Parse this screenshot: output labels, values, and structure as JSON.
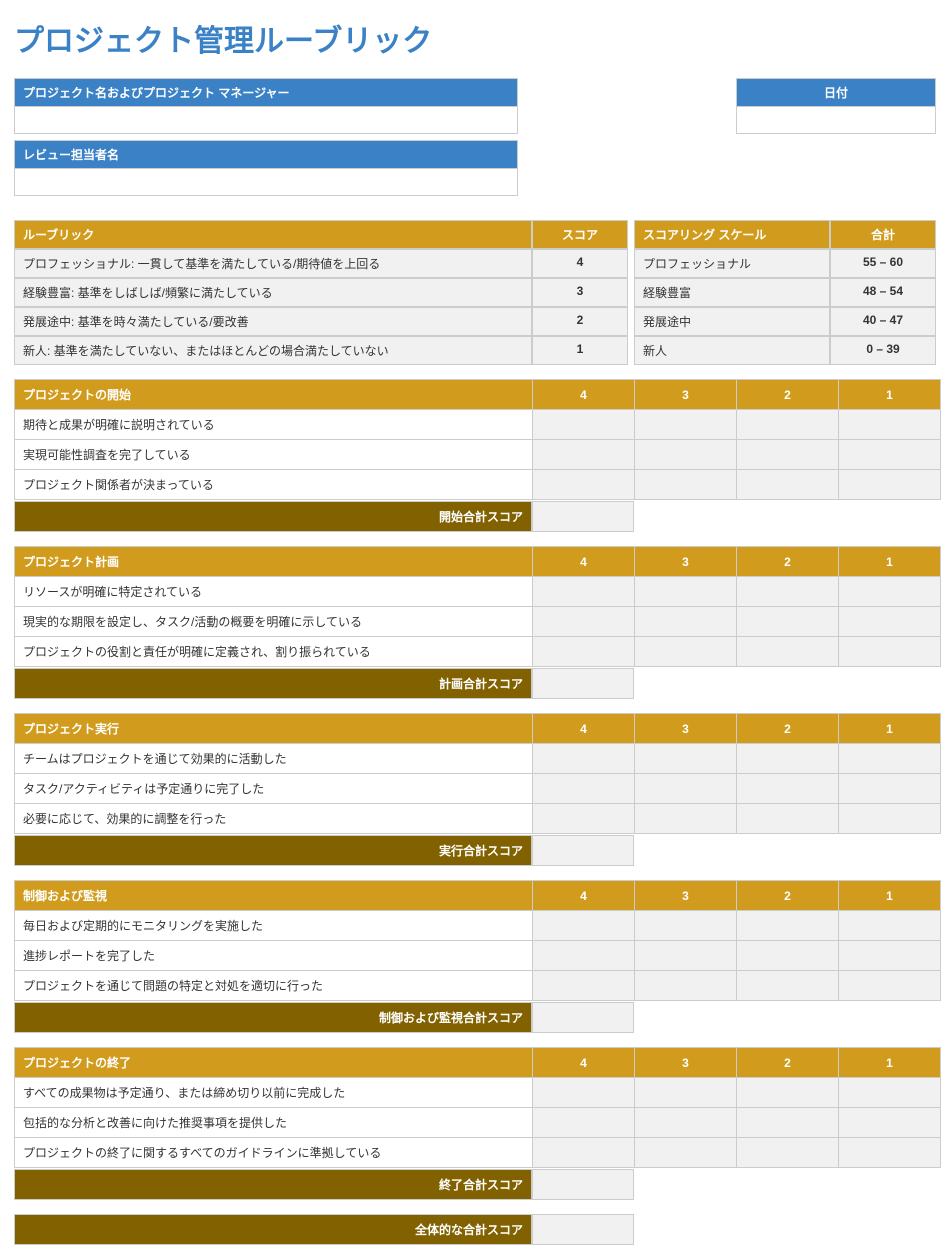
{
  "title": "プロジェクト管理ルーブリック",
  "info": {
    "project_header": "プロジェクト名およびプロジェクト マネージャー",
    "project_value": "",
    "reviewer_header": "レビュー担当者名",
    "reviewer_value": "",
    "date_header": "日付",
    "date_value": ""
  },
  "rubric": {
    "rubric_header": "ルーブリック",
    "score_header": "スコア",
    "scale_header": "スコアリング スケール",
    "total_header": "合計",
    "rows": [
      {
        "desc": "プロフェッショナル: 一貫して基準を満たしている/期待値を上回る",
        "score": "4",
        "scale": "プロフェッショナル",
        "range": "55 – 60"
      },
      {
        "desc": "経験豊富: 基準をしばしば/頻繁に満たしている",
        "score": "3",
        "scale": "経験豊富",
        "range": "48 – 54"
      },
      {
        "desc": "発展途中: 基準を時々満たしている/要改善",
        "score": "2",
        "scale": "発展途中",
        "range": "40 – 47"
      },
      {
        "desc": "新人: 基準を満たしていない、またはほとんどの場合満たしていない",
        "score": "1",
        "scale": "新人",
        "range": "0 – 39"
      }
    ]
  },
  "score_cols": [
    "4",
    "3",
    "2",
    "1"
  ],
  "sections": [
    {
      "title": "プロジェクトの開始",
      "rows": [
        "期待と成果が明確に説明されている",
        "実現可能性調査を完了している",
        "プロジェクト関係者が決まっている"
      ],
      "subtotal_label": "開始合計スコア",
      "subtotal_value": ""
    },
    {
      "title": "プロジェクト計画",
      "rows": [
        "リソースが明確に特定されている",
        "現実的な期限を設定し、タスク/活動の概要を明確に示している",
        "プロジェクトの役割と責任が明確に定義され、割り振られている"
      ],
      "subtotal_label": "計画合計スコア",
      "subtotal_value": ""
    },
    {
      "title": "プロジェクト実行",
      "rows": [
        "チームはプロジェクトを通じて効果的に活動した",
        "タスク/アクティビティは予定通りに完了した",
        "必要に応じて、効果的に調整を行った"
      ],
      "subtotal_label": "実行合計スコア",
      "subtotal_value": ""
    },
    {
      "title": "制御および監視",
      "rows": [
        "毎日および定期的にモニタリングを実施した",
        "進捗レポートを完了した",
        "プロジェクトを通じて問題の特定と対処を適切に行った"
      ],
      "subtotal_label": "制御および監視合計スコア",
      "subtotal_value": ""
    },
    {
      "title": "プロジェクトの終了",
      "rows": [
        "すべての成果物は予定通り、または締め切り以前に完成した",
        "包括的な分析と改善に向けた推奨事項を提供した",
        "プロジェクトの終了に関するすべてのガイドラインに準拠している"
      ],
      "subtotal_label": "終了合計スコア",
      "subtotal_value": ""
    }
  ],
  "overall": {
    "label": "全体的な合計スコア",
    "value": ""
  }
}
